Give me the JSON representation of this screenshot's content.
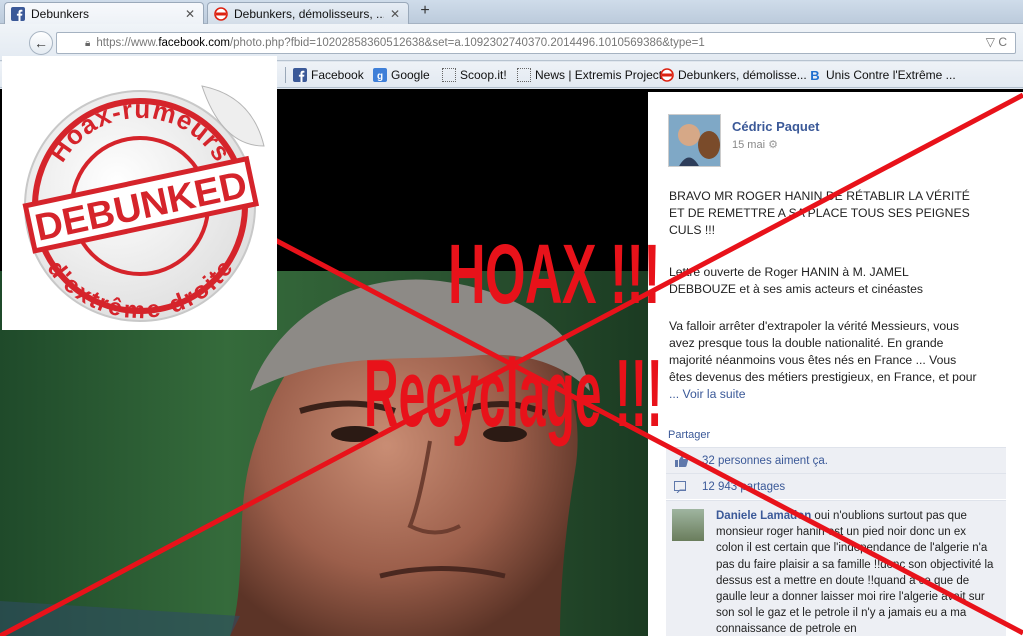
{
  "tabs": [
    {
      "title": "Debunkers",
      "close": "✕",
      "active": true
    },
    {
      "title": "Debunkers, démolisseurs, ...",
      "close": "✕",
      "active": false
    }
  ],
  "new_tab": "+",
  "nav": {
    "back": "←",
    "url_prefix": "https://www.",
    "url_host": "facebook.com",
    "url_path": "/photo.php?fbid=10202858360512638&set=a.1092302740370.2014496.1010569386&type=1",
    "url_tail": "▽ C"
  },
  "bookmarks": [
    {
      "label": "Facebook",
      "icon": "facebook-icon"
    },
    {
      "label": "Google",
      "icon": "google-icon"
    },
    {
      "label": "Scoop.it!",
      "icon": "page-icon"
    },
    {
      "label": "News | Extremis Project",
      "icon": "page-icon"
    },
    {
      "label": "Debunkers, démolisse...",
      "icon": "debunkers-icon"
    },
    {
      "label": "Unis Contre l'Extrême ...",
      "icon": "blogger-icon"
    }
  ],
  "post": {
    "author": "Cédric Paquet",
    "date": "15 mai",
    "paragraph1": [
      "BRAVO MR ROGER HANIN DE RÉTABLIR LA VÉRITÉ",
      "ET DE REMETTRE A SA PLACE TOUS SES PEIGNES",
      "CULS !!!"
    ],
    "paragraph2": [
      "Lettre ouverte de Roger HANIN à M. JAMEL",
      "DEBBOUZE et à ses amis acteurs et cinéastes"
    ],
    "paragraph3": [
      "Va falloir arrêter d'extrapoler la vérité Messieurs, vous",
      "avez presque tous la double nationalité. En grande",
      "majorité néanmoins vous êtes nés en France ... Vous",
      "êtes devenus des métiers prestigieux, en France, et pour",
      "... Voir la suite"
    ],
    "share_action": "Partager",
    "likes": "32 personnes aiment ça.",
    "shares": "12 943 partages",
    "comment_author": "Daniele Lamadon",
    "comment_text": "oui n'oublions surtout pas que monsieur roger hanin est un pied noir donc un ex colon il est certain que l'independance de l'algerie n'a pas du faire plaisir a sa famille !!donc son objectivité la dessus est a mettre en doute !!quand a ce que de gaulle leur a donner laisser moi rire l'algerie avait sur son sol le gaz et le petrole il n'y a jamais eu a ma connaissance de petrole en"
  },
  "sticker": {
    "top_text": "Hoax-rumeurs",
    "center_text": "DEBUNKED",
    "bottom_text": "d'extrême-droite"
  },
  "overlay": {
    "hoax": "HOAX !!!",
    "recyclage": "Recyclage !!!"
  },
  "colors": {
    "facebook_blue": "#3b5998",
    "stamp_red": "#e8121a"
  }
}
